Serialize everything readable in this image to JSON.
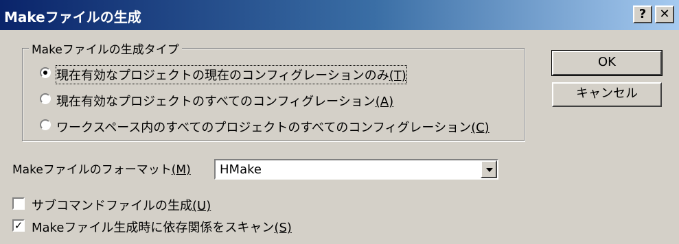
{
  "window": {
    "title": "Makeファイルの生成",
    "help_glyph": "?",
    "close_glyph": "✕"
  },
  "group": {
    "legend": "Makeファイルの生成タイプ",
    "options": [
      {
        "text": "現在有効なプロジェクトの現在のコンフィグレーションのみ",
        "accel": "(T)",
        "selected": true
      },
      {
        "text": "現在有効なプロジェクトのすべてのコンフィグレーション",
        "accel": "(A)",
        "selected": false
      },
      {
        "text": "ワークスペース内のすべてのプロジェクトのすべてのコンフィグレーション",
        "accel": "(C)",
        "selected": false
      }
    ]
  },
  "buttons": {
    "ok": "OK",
    "cancel": "キャンセル"
  },
  "format": {
    "label": "Makeファイルのフォーマット",
    "accel": "(M)",
    "value": "HMake"
  },
  "checks": [
    {
      "text": "サブコマンドファイルの生成",
      "accel": "(U)",
      "checked": false
    },
    {
      "text": "Makeファイル生成時に依存関係をスキャン",
      "accel": "(S)",
      "checked": true
    }
  ],
  "check_mark": "✓"
}
